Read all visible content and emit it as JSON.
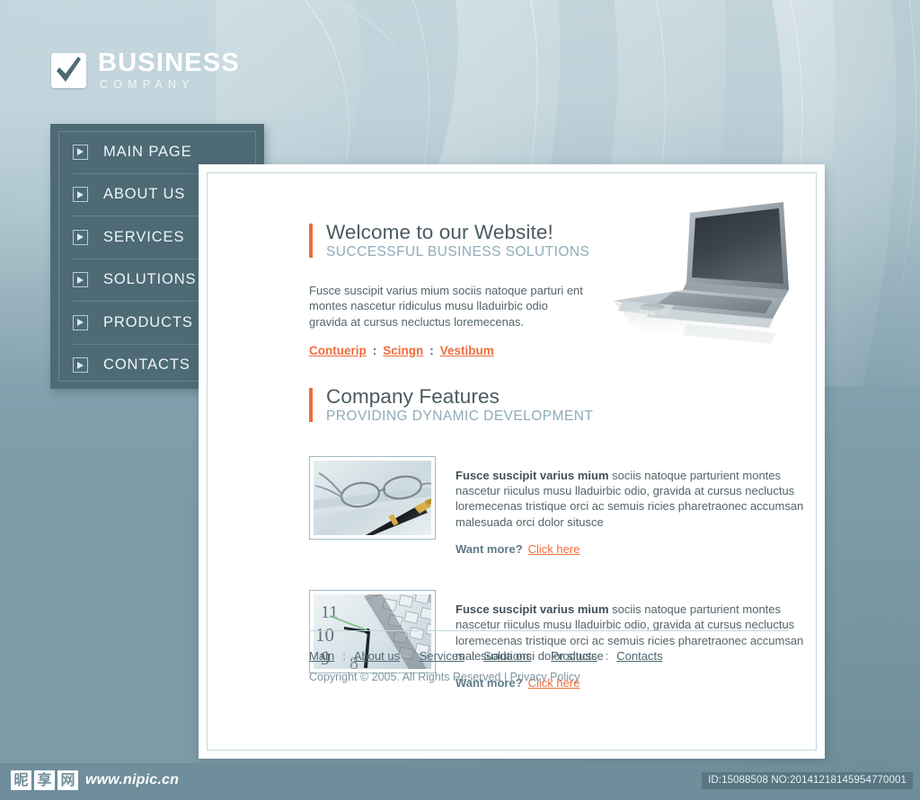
{
  "brand": {
    "name": "BUSINESS",
    "tagline": "COMPANY",
    "logo_icon": "checkmark-icon"
  },
  "nav": {
    "items": [
      {
        "label": "MAIN PAGE",
        "icon": "play-square-icon"
      },
      {
        "label": "ABOUT US",
        "icon": "play-square-icon"
      },
      {
        "label": "SERVICES",
        "icon": "play-square-icon"
      },
      {
        "label": "SOLUTIONS",
        "icon": "play-square-icon"
      },
      {
        "label": "PRODUCTS",
        "icon": "play-square-icon"
      },
      {
        "label": "CONTACTS",
        "icon": "play-square-icon"
      }
    ]
  },
  "welcome": {
    "title": "Welcome to our Website!",
    "subtitle": "SUCCESSFUL BUSINESS SOLUTIONS",
    "paragraph": "Fusce suscipit varius mium sociis natoque parturi ent montes nascetur ridiculus musu lladuirbic odio gravida at cursus necluctus loremecenas.",
    "links": [
      "Contuerip",
      "Scingn",
      "Vestibum"
    ],
    "separator": ":",
    "hero_image": "laptop-photo"
  },
  "features": {
    "title": "Company Features",
    "subtitle": "PROVIDING DYNAMIC DEVELOPMENT",
    "items": [
      {
        "thumb": "glasses-and-pen-photo",
        "lead": "Fusce suscipit varius mium",
        "body": " sociis natoque parturient montes nascetur riiculus musu lladuirbic odio, gravida at cursus necluctus loremecenas tristique orci ac semuis ricies pharetraonec accumsan malesuada orci  dolor situsce",
        "more_label": "Want more?",
        "more_link": "Click here"
      },
      {
        "thumb": "clock-and-calculator-photo",
        "lead": "Fusce suscipit varius mium",
        "body": " sociis natoque parturient montes nascetur riiculus musu lladuirbic odio, gravida at cursus necluctus loremecenas tristique orci ac semuis ricies pharetraonec accumsan malesuada orci  dolor situsce",
        "more_label": "Want more?",
        "more_link": "Click here"
      }
    ]
  },
  "footer": {
    "links": [
      "Main",
      "About us",
      "Services",
      "Solutions",
      "Products",
      "Contacts"
    ],
    "separator": ":",
    "copyright": "Copyright © 2005. All Rights Reserved | Privacy Policy"
  },
  "watermark": {
    "cn_chars": [
      "昵",
      "享",
      "网"
    ],
    "url": "www.nipic.cn",
    "id_text": "ID:15088508 NO:20141218145954770001"
  },
  "colors": {
    "accent": "#ec6c3c",
    "nav_panel": "#4d6a75",
    "page_bg": "#7d9aa6",
    "heading": "#4b5a61",
    "subheading": "#8fabb8"
  }
}
